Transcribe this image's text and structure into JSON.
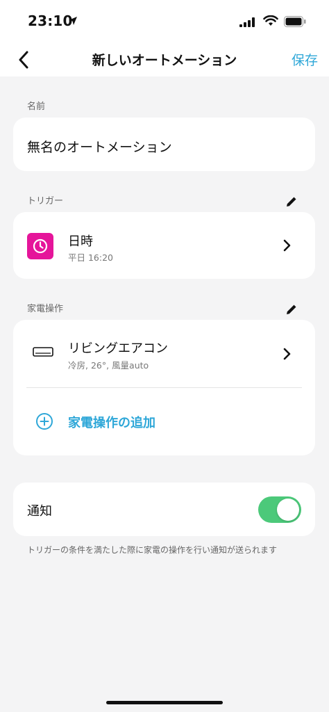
{
  "status_bar": {
    "time": "23:10"
  },
  "nav": {
    "title": "新しいオートメーション",
    "save_label": "保存"
  },
  "name_section": {
    "label": "名前",
    "value": "無名のオートメーション"
  },
  "trigger_section": {
    "label": "トリガー",
    "item": {
      "title": "日時",
      "subtitle": "平日 16:20",
      "icon": "clock-icon",
      "icon_color": "#e5159a"
    }
  },
  "appliance_section": {
    "label": "家電操作",
    "item": {
      "title": "リビングエアコン",
      "subtitle": "冷房, 26°, 風量auto",
      "icon": "air-conditioner-icon"
    },
    "add_label": "家電操作の追加"
  },
  "notification_section": {
    "label": "通知",
    "enabled": true,
    "toggle_color": "#4cc97a",
    "note": "トリガーの条件を満たした際に家電の操作を行い通知が送られます"
  },
  "colors": {
    "accent": "#2ea7d8",
    "background": "#f4f4f5"
  }
}
